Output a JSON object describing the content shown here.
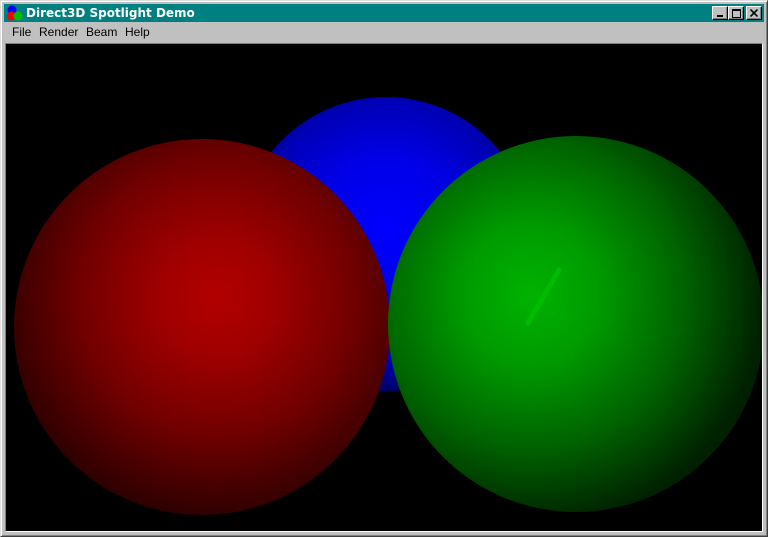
{
  "window": {
    "title": "Direct3D Spotlight Demo",
    "app_icon": "direct3d-app-icon",
    "controls": [
      "minimize-icon",
      "maximize-icon",
      "close-icon"
    ]
  },
  "menu": {
    "items": [
      {
        "label": "File"
      },
      {
        "label": "Render"
      },
      {
        "label": "Beam"
      },
      {
        "label": "Help"
      }
    ]
  },
  "scene": {
    "background": "#000000",
    "spheres": [
      {
        "name": "blue",
        "color": "#0000ff"
      },
      {
        "name": "red",
        "color": "#b00000"
      },
      {
        "name": "green",
        "color": "#00b000"
      }
    ]
  }
}
